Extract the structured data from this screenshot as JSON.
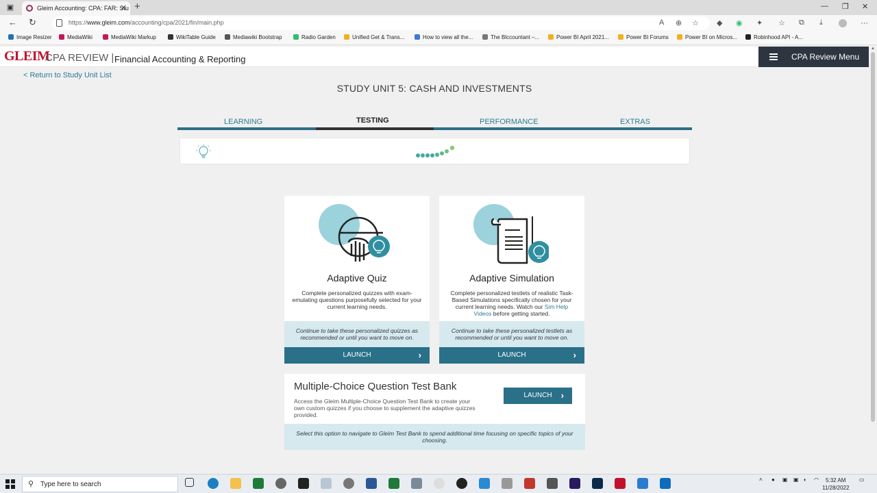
{
  "browser": {
    "tab_title": "Gleim Accounting: CPA: FAR: Stu",
    "url_prefix": "https://",
    "url_domain": "www.gleim.com",
    "url_path": "/accounting/cpa/2021/fin/main.php",
    "bookmarks": [
      {
        "label": "Image Resizer",
        "color": "#1f73b7"
      },
      {
        "label": "MediaWiki",
        "color": "#c2185b"
      },
      {
        "label": "MediaWiki Markup",
        "color": "#c2185b"
      },
      {
        "label": "WikiTable Guide",
        "color": "#333333"
      },
      {
        "label": "Mediawiki Bootstrap",
        "color": "#555555"
      },
      {
        "label": "Radio Garden",
        "color": "#2fbf71"
      },
      {
        "label": "Unified Get & Trans...",
        "color": "#f2b01e"
      },
      {
        "label": "How to view all the...",
        "color": "#3a7bd5"
      },
      {
        "label": "The Blccountant –...",
        "color": "#777777"
      },
      {
        "label": "Power BI April 2021...",
        "color": "#f2b01e"
      },
      {
        "label": "Power BI Forums",
        "color": "#f2b01e"
      },
      {
        "label": "Power BI on Micros...",
        "color": "#f2b01e"
      },
      {
        "label": "Robinhood API - A...",
        "color": "#222222"
      }
    ]
  },
  "header": {
    "logo": "GLEIM",
    "logo_sub": "CPA REVIEW |",
    "course": "Financial Accounting & Reporting",
    "menu_label": "CPA Review Menu"
  },
  "page": {
    "return_link": "< Return to Study Unit List",
    "unit_title": "STUDY UNIT 5: CASH AND INVESTMENTS",
    "tabs": [
      {
        "label": "LEARNING"
      },
      {
        "label": "TESTING"
      },
      {
        "label": "PERFORMANCE"
      },
      {
        "label": "EXTRAS"
      }
    ],
    "active_tab": "TESTING"
  },
  "cards": {
    "quiz": {
      "title": "Adaptive Quiz",
      "desc": "Complete personalized quizzes with exam-emulating questions purposefully selected for your current learning needs.",
      "note": "Continue to take these personalized quizzes as recommended or until you want to move on.",
      "launch": "LAUNCH"
    },
    "sim": {
      "title": "Adaptive Simulation",
      "desc_before": "Complete personalized testlets of realistic Task-Based Simulations specifically chosen for your current learning needs. Watch our ",
      "desc_link": "Sim Help Videos",
      "desc_after": " before getting started.",
      "note": "Continue to take these personalized testlets as recommended or until you want to move on.",
      "launch": "LAUNCH"
    },
    "mc": {
      "title": "Multiple-Choice Question Test Bank",
      "desc": "Access the Gleim Multiple-Choice Question Test Bank to create your own custom quizzes if you choose to supplement the adaptive quizzes provided.",
      "launch": "LAUNCH",
      "note": "Select this option to navigate to Gleim Test Bank to spend additional time focusing on specific topics of your choosing."
    }
  },
  "taskbar": {
    "search_placeholder": "Type here to search",
    "time": "5:32 AM",
    "date": "11/28/2022"
  },
  "colors": {
    "accent": "#2a7089",
    "brand_red": "#c0122c",
    "note_bg": "#d6e9ee"
  }
}
